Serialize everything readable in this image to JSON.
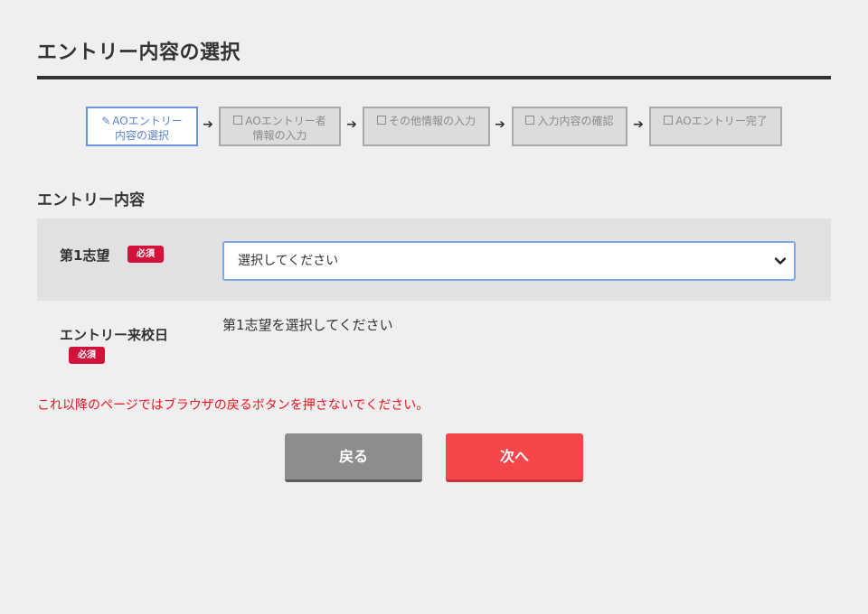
{
  "page": {
    "title": "エントリー内容の選択"
  },
  "steps": [
    {
      "label_line1": "AOエントリー",
      "label_line2": "内容の選択",
      "icon": "edit-icon",
      "active": true
    },
    {
      "label_line1": "AOエントリー者",
      "label_line2": "情報の入力",
      "icon": "checkbox-icon",
      "active": false
    },
    {
      "label_line1": "その他情報の入力",
      "label_line2": "",
      "icon": "checkbox-icon",
      "active": false
    },
    {
      "label_line1": "入力内容の確認",
      "label_line2": "",
      "icon": "checkbox-icon",
      "active": false
    },
    {
      "label_line1": "AOエントリー完了",
      "label_line2": "",
      "icon": "checkbox-icon",
      "active": false
    }
  ],
  "section": {
    "heading": "エントリー内容"
  },
  "form": {
    "first_choice": {
      "label": "第1志望",
      "required_badge": "必須",
      "select_value": "選択してください"
    },
    "entry_date": {
      "label": "エントリー来校日",
      "required_badge": "必須",
      "message": "第1志望を選択してください"
    }
  },
  "warning": "これ以降のページではブラウザの戻るボタンを押さないでください。",
  "buttons": {
    "back": "戻る",
    "next": "次へ"
  },
  "colors": {
    "background": "#efefef",
    "active_step": "#5b83c9",
    "badge": "#d2123b",
    "warning": "#e8141e",
    "next_button": "#f5464c",
    "back_button": "#8d8d8d"
  }
}
